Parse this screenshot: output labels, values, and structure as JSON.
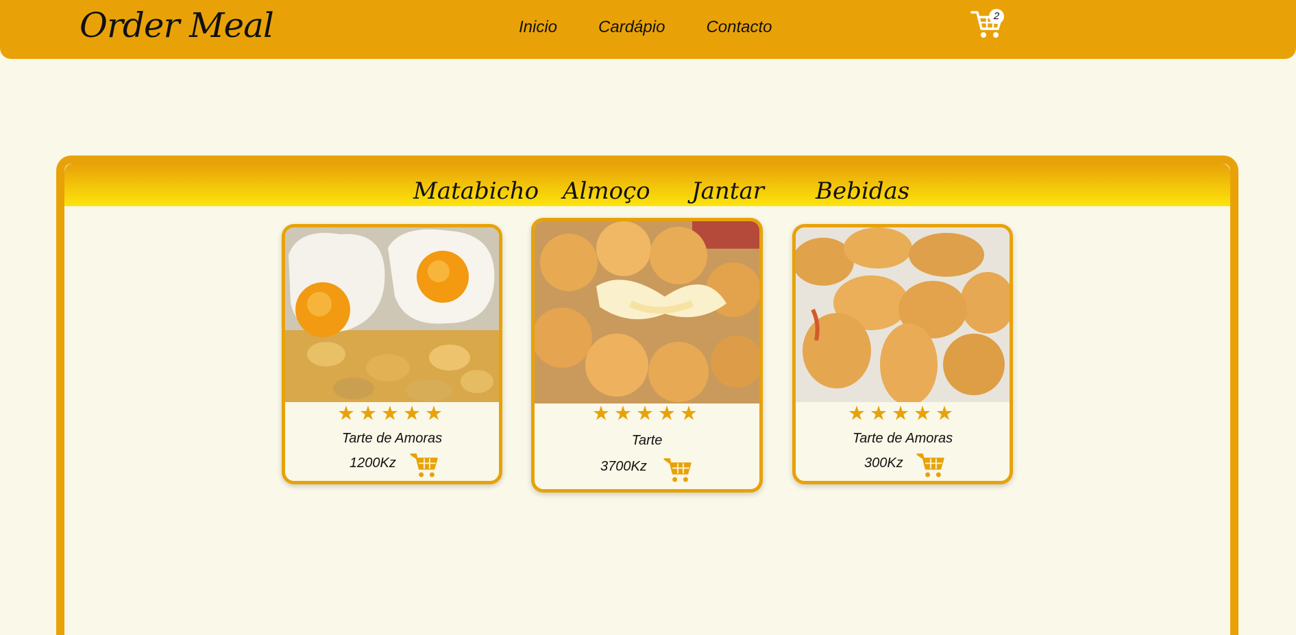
{
  "header": {
    "logo": "Order Meal",
    "nav": [
      "Inicio",
      "Cardápio",
      "Contacto"
    ],
    "cart_count": "2"
  },
  "menu": {
    "tabs": [
      "Matabicho",
      "Almoço",
      "Jantar",
      "Bebidas"
    ]
  },
  "products": [
    {
      "name": "Tarte de Amoras",
      "price": "1200Kz",
      "rating": 5,
      "image": "fried-eggs-with-potatoes"
    },
    {
      "name": "Tarte",
      "price": "3700Kz",
      "rating": 5,
      "image": "cheese-croquettes"
    },
    {
      "name": "Tarte de Amoras",
      "price": "300Kz",
      "rating": 5,
      "image": "shrimp-rissoles"
    }
  ],
  "colors": {
    "accent": "#e8a208",
    "background": "#faf8e8",
    "tab_gradient_end": "#fde40c"
  }
}
